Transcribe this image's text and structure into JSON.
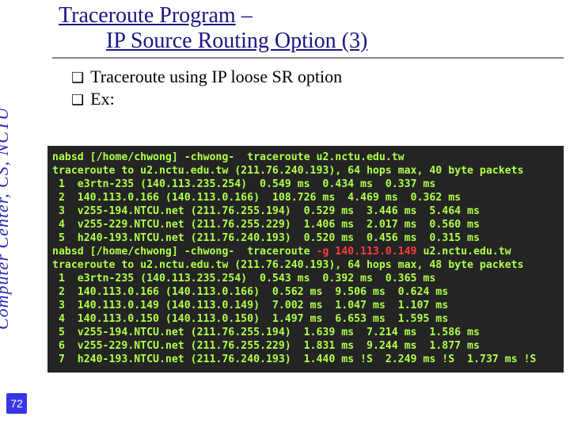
{
  "side_label": "Computer Center, CS, NCTU",
  "page_number": "72",
  "title": {
    "line1_pre": "Traceroute Program",
    "dash": " –",
    "line2": "IP Source Routing Option (3)"
  },
  "bullets": [
    "Traceroute using IP loose SR option",
    "Ex:"
  ],
  "terminal": {
    "lines": [
      "nabsd [/home/chwong] -chwong-  traceroute u2.nctu.edu.tw",
      "traceroute to u2.nctu.edu.tw (211.76.240.193), 64 hops max, 40 byte packets",
      " 1  e3rtn-235 (140.113.235.254)  0.549 ms  0.434 ms  0.337 ms",
      " 2  140.113.0.166 (140.113.0.166)  108.726 ms  4.469 ms  0.362 ms",
      " 3  v255-194.NTCU.net (211.76.255.194)  0.529 ms  3.446 ms  5.464 ms",
      " 4  v255-229.NTCU.net (211.76.255.229)  1.406 ms  2.017 ms  0.560 ms",
      " 5  h240-193.NTCU.net (211.76.240.193)  0.520 ms  0.456 ms  0.315 ms",
      "nabsd [/home/chwong] -chwong-  traceroute ",
      "-g 140.113.0.149",
      " u2.nctu.edu.tw",
      "traceroute to u2.nctu.edu.tw (211.76.240.193), 64 hops max, 48 byte packets",
      " 1  e3rtn-235 (140.113.235.254)  0.543 ms  0.392 ms  0.365 ms",
      " 2  140.113.0.166 (140.113.0.166)  0.562 ms  9.506 ms  0.624 ms",
      " 3  140.113.0.149 (140.113.0.149)  7.002 ms  1.047 ms  1.107 ms",
      " 4  140.113.0.150 (140.113.0.150)  1.497 ms  6.653 ms  1.595 ms",
      " 5  v255-194.NTCU.net (211.76.255.194)  1.639 ms  7.214 ms  1.586 ms",
      " 6  v255-229.NTCU.net (211.76.255.229)  1.831 ms  9.244 ms  1.877 ms",
      " 7  h240-193.NTCU.net (211.76.240.193)  1.440 ms !S  2.249 ms !S  1.737 ms !S"
    ]
  }
}
